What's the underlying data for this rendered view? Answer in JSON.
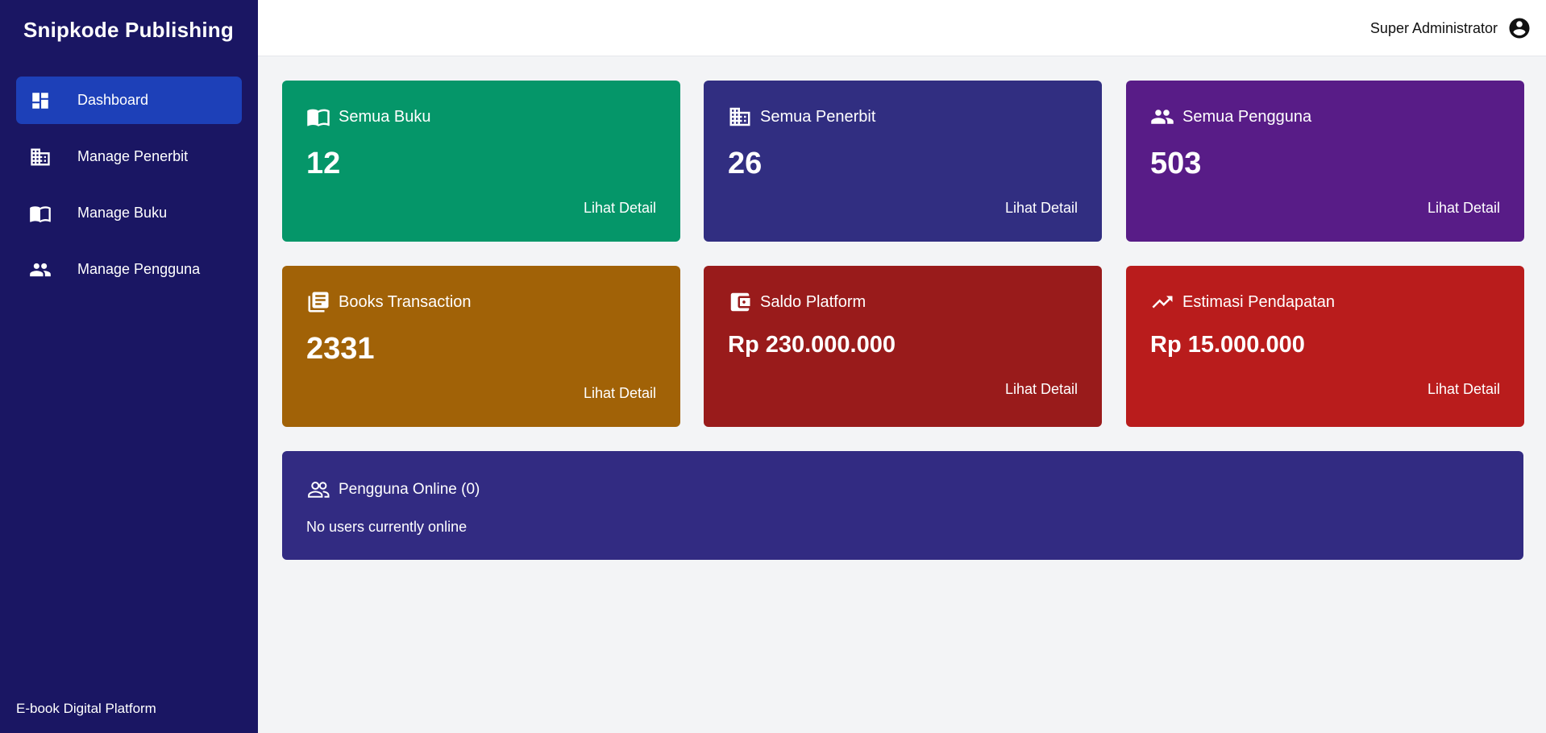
{
  "sidebar": {
    "brand": "Snipkode Publishing",
    "items": [
      {
        "label": "Dashboard",
        "icon": "dashboard-icon",
        "active": true
      },
      {
        "label": "Manage Penerbit",
        "icon": "building-icon"
      },
      {
        "label": "Manage Buku",
        "icon": "book-icon"
      },
      {
        "label": "Manage Pengguna",
        "icon": "users-icon"
      }
    ],
    "footer": "E-book Digital Platform"
  },
  "header": {
    "user_name": "Super Administrator",
    "user_icon": "account-circle-icon"
  },
  "cards": [
    {
      "title": "Semua Buku",
      "value": "12",
      "link": "Lihat Detail",
      "icon": "book-icon",
      "color": "#059669"
    },
    {
      "title": "Semua Penerbit",
      "value": "26",
      "link": "Lihat Detail",
      "icon": "building-icon",
      "color": "#312e81"
    },
    {
      "title": "Semua Pengguna",
      "value": "503",
      "link": "Lihat Detail",
      "icon": "users-icon",
      "color": "#581c87"
    },
    {
      "title": "Books Transaction",
      "value": "2331",
      "link": "Lihat Detail",
      "icon": "library-books-icon",
      "color": "#a16207"
    },
    {
      "title": "Saldo Platform",
      "value": "Rp 230.000.000",
      "link": "Lihat Detail",
      "icon": "wallet-icon",
      "color": "#991b1b"
    },
    {
      "title": "Estimasi Pendapatan",
      "value": "Rp 15.000.000",
      "link": "Lihat Detail",
      "icon": "trending-up-icon",
      "color": "#b91c1c"
    }
  ],
  "online": {
    "title": "Pengguna Online (0)",
    "empty_message": "No users currently online",
    "icon": "users-outline-icon",
    "color": "#322b82"
  }
}
